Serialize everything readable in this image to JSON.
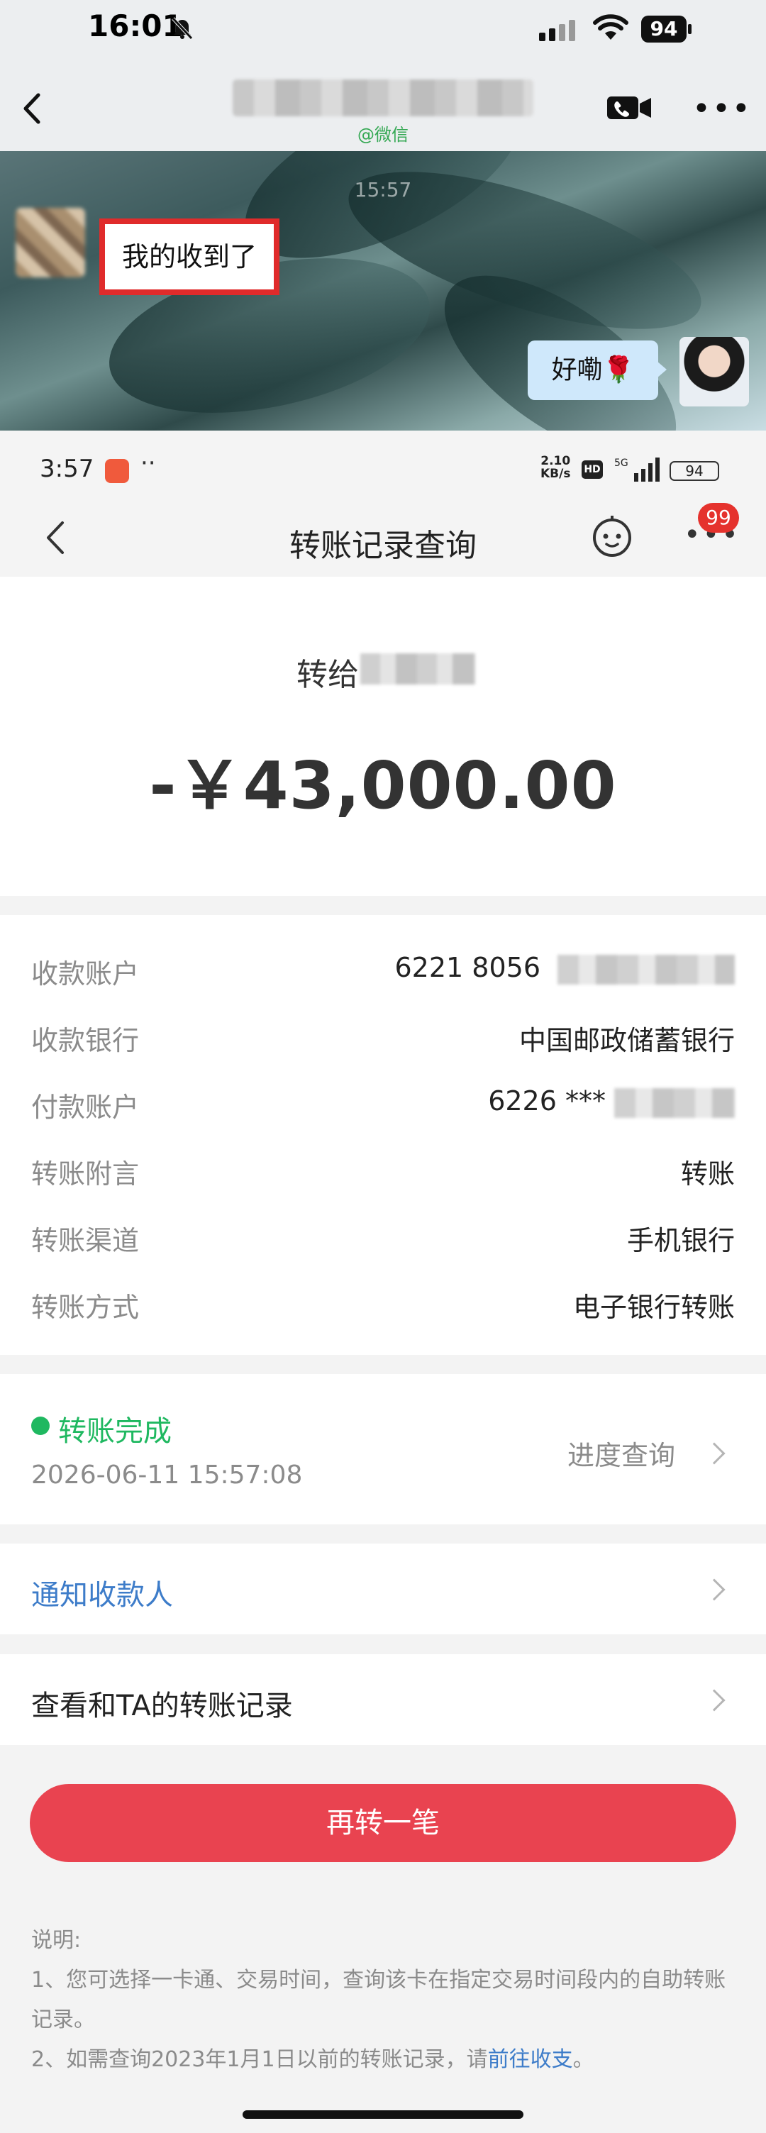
{
  "outer_status": {
    "time": "16:01",
    "battery": "94"
  },
  "chat": {
    "subtitle": "@微信",
    "timestamp": "15:57",
    "left_message": "我的收到了",
    "right_message": "好嘞🌹"
  },
  "inner_status": {
    "time": "3:57",
    "dots": "··",
    "speed": "2.10",
    "speed_unit": "KB/s",
    "hd": "HD",
    "network": "5G",
    "battery": "94"
  },
  "nav": {
    "title": "转账记录查询",
    "badge": "99"
  },
  "transfer": {
    "to_label": "转给",
    "amount": "-￥43,000.00"
  },
  "details": {
    "rows": [
      {
        "label": "收款账户",
        "value": "6221 8056"
      },
      {
        "label": "收款银行",
        "value": "中国邮政储蓄银行"
      },
      {
        "label": "付款账户",
        "value": "6226 ***"
      },
      {
        "label": "转账附言",
        "value": "转账"
      },
      {
        "label": "转账渠道",
        "value": "手机银行"
      },
      {
        "label": "转账方式",
        "value": "电子银行转账"
      }
    ]
  },
  "status": {
    "label": "转账完成",
    "datetime": "2026-06-11 15:57:08",
    "progress_link": "进度查询",
    "color": "#1fb860"
  },
  "actions": {
    "notify_payee": "通知收款人",
    "view_history": "查看和TA的转账记录",
    "transfer_again": "再转一笔"
  },
  "notes": {
    "heading": "说明:",
    "line1": "1、您可选择一卡通、交易时间，查询该卡在指定交易时间段内的自助转账记录。",
    "line2_prefix": "2、如需查询2023年1月1日以前的转账记录，请",
    "line2_link": "前往收支",
    "line2_suffix": "。"
  },
  "colors": {
    "accent_red": "#e94350",
    "link_blue": "#3d7cc9",
    "success_green": "#1fb860"
  }
}
